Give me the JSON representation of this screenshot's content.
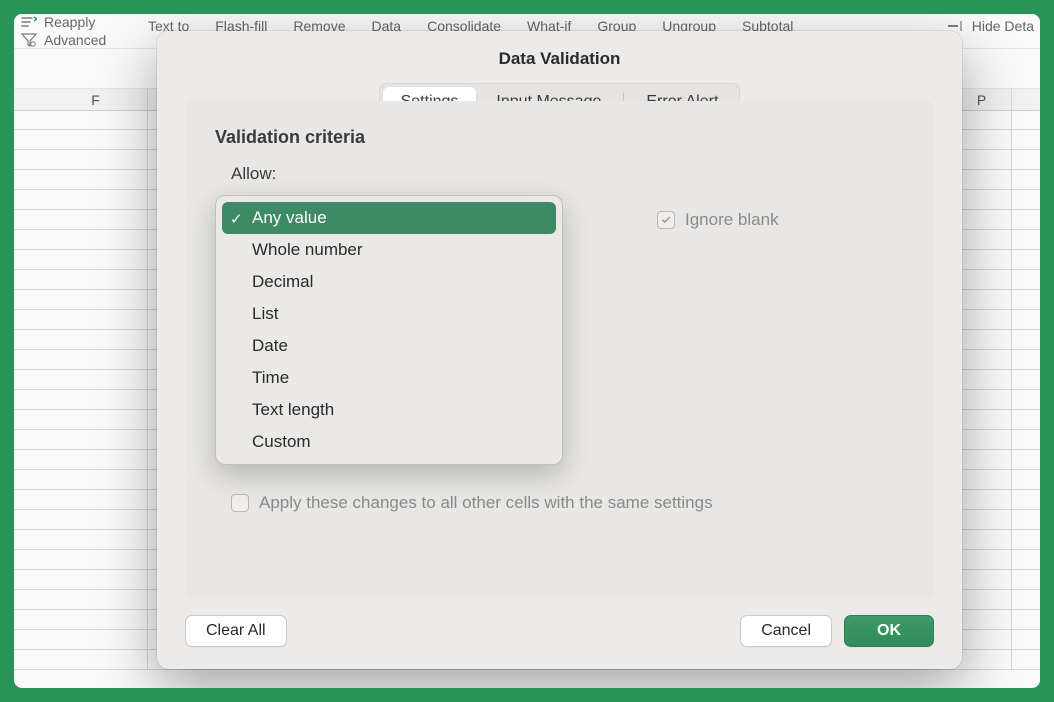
{
  "ribbon": {
    "reapply": "Reapply",
    "advanced": "Advanced",
    "text_to": "Text to",
    "flash_fill": "Flash-fill",
    "remove": "Remove",
    "data": "Data",
    "consolidate": "Consolidate",
    "what_if": "What-if",
    "group": "Group",
    "ungroup": "Ungroup",
    "subtotal": "Subtotal",
    "hide_deta": "Hide Deta"
  },
  "columns": {
    "f": "F",
    "p": "P"
  },
  "dialog": {
    "title": "Data Validation",
    "tabs": {
      "settings": "Settings",
      "input_message": "Input Message",
      "error_alert": "Error Alert"
    },
    "panel": {
      "title": "Validation criteria",
      "allow_label": "Allow:",
      "ignore_blank": "Ignore blank",
      "apply_changes": "Apply these changes to all other cells with the same settings"
    },
    "allow_options": {
      "any_value": "Any value",
      "whole_number": "Whole number",
      "decimal": "Decimal",
      "list": "List",
      "date": "Date",
      "time": "Time",
      "text_length": "Text length",
      "custom": "Custom"
    },
    "buttons": {
      "clear_all": "Clear All",
      "cancel": "Cancel",
      "ok": "OK"
    }
  }
}
